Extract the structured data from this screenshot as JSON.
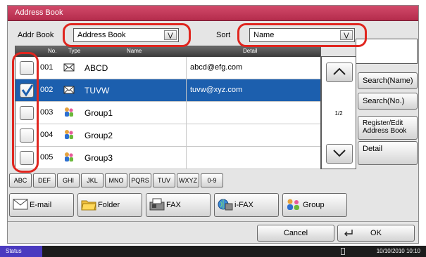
{
  "window": {
    "title": "Address Book"
  },
  "header": {
    "addr_book_label": "Addr Book",
    "addr_book_value": "Address Book",
    "sort_label": "Sort",
    "sort_value": "Name"
  },
  "table": {
    "columns": [
      "No.",
      "Type",
      "Name",
      "Detail"
    ],
    "rows": [
      {
        "no": "001",
        "type": "email",
        "name": "ABCD",
        "detail": "abcd@efg.com",
        "checked": false,
        "selected": false
      },
      {
        "no": "002",
        "type": "email",
        "name": "TUVW",
        "detail": "tuvw@xyz.com",
        "checked": true,
        "selected": true
      },
      {
        "no": "003",
        "type": "group",
        "name": "Group1",
        "detail": "",
        "checked": false,
        "selected": false
      },
      {
        "no": "004",
        "type": "group",
        "name": "Group2",
        "detail": "",
        "checked": false,
        "selected": false
      },
      {
        "no": "005",
        "type": "group",
        "name": "Group3",
        "detail": "",
        "checked": false,
        "selected": false
      }
    ]
  },
  "pager": {
    "page": "1/2",
    "up_icon": "chevron-up-icon",
    "down_icon": "chevron-down-icon"
  },
  "side_buttons": {
    "search_name": "Search(Name)",
    "search_no": "Search(No.)",
    "register_line1": "Register/Edit",
    "register_line2": "Address Book",
    "detail": "Detail"
  },
  "alpha_tabs": [
    "ABC",
    "DEF",
    "GHI",
    "JKL",
    "MNO",
    "PQRS",
    "TUV",
    "WXYZ",
    "0-9"
  ],
  "dest_buttons": [
    {
      "label": "E-mail",
      "icon": "envelope-icon"
    },
    {
      "label": "Folder",
      "icon": "folder-icon"
    },
    {
      "label": "FAX",
      "icon": "fax-icon"
    },
    {
      "label": "i-FAX",
      "icon": "ifax-icon"
    },
    {
      "label": "Group",
      "icon": "group-icon"
    }
  ],
  "footer": {
    "cancel": "Cancel",
    "ok": "OK"
  },
  "status": {
    "label": "Status",
    "datetime": "10/10/2010  10:10"
  },
  "colors": {
    "title_bar": "#c33a5a",
    "selected_row": "#1c5fae",
    "highlight_ring": "#e0261f",
    "status_label": "#4a3ac0"
  }
}
